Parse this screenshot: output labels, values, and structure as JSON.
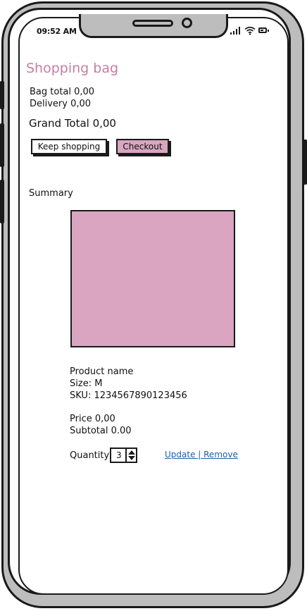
{
  "status_bar": {
    "time": "09:52 AM",
    "icons": [
      "signal-icon",
      "wifi-icon",
      "battery-icon"
    ]
  },
  "page": {
    "title": "Shopping bag"
  },
  "totals": {
    "bag_total": "Bag total 0,00",
    "delivery": "Delivery 0,00",
    "grand_total": "Grand Total 0,00"
  },
  "actions": {
    "keep_shopping": "Keep shopping",
    "checkout": "Checkout"
  },
  "summary": {
    "label": "Summary",
    "product": {
      "name": "Product name",
      "size": "Size: M",
      "sku": "SKU: 1234567890123456",
      "price": "Price 0,00",
      "subtotal": "Subtotal 0.00",
      "quantity_label": "Quantity",
      "quantity_value": "3",
      "update_remove": "Update | Remove"
    }
  },
  "colors": {
    "accent": "#c77da3",
    "product_image": "#d9a5c1",
    "checkout_button": "#d8a6c0",
    "link": "#1f5fa8",
    "frame": "#bdbdbd"
  }
}
